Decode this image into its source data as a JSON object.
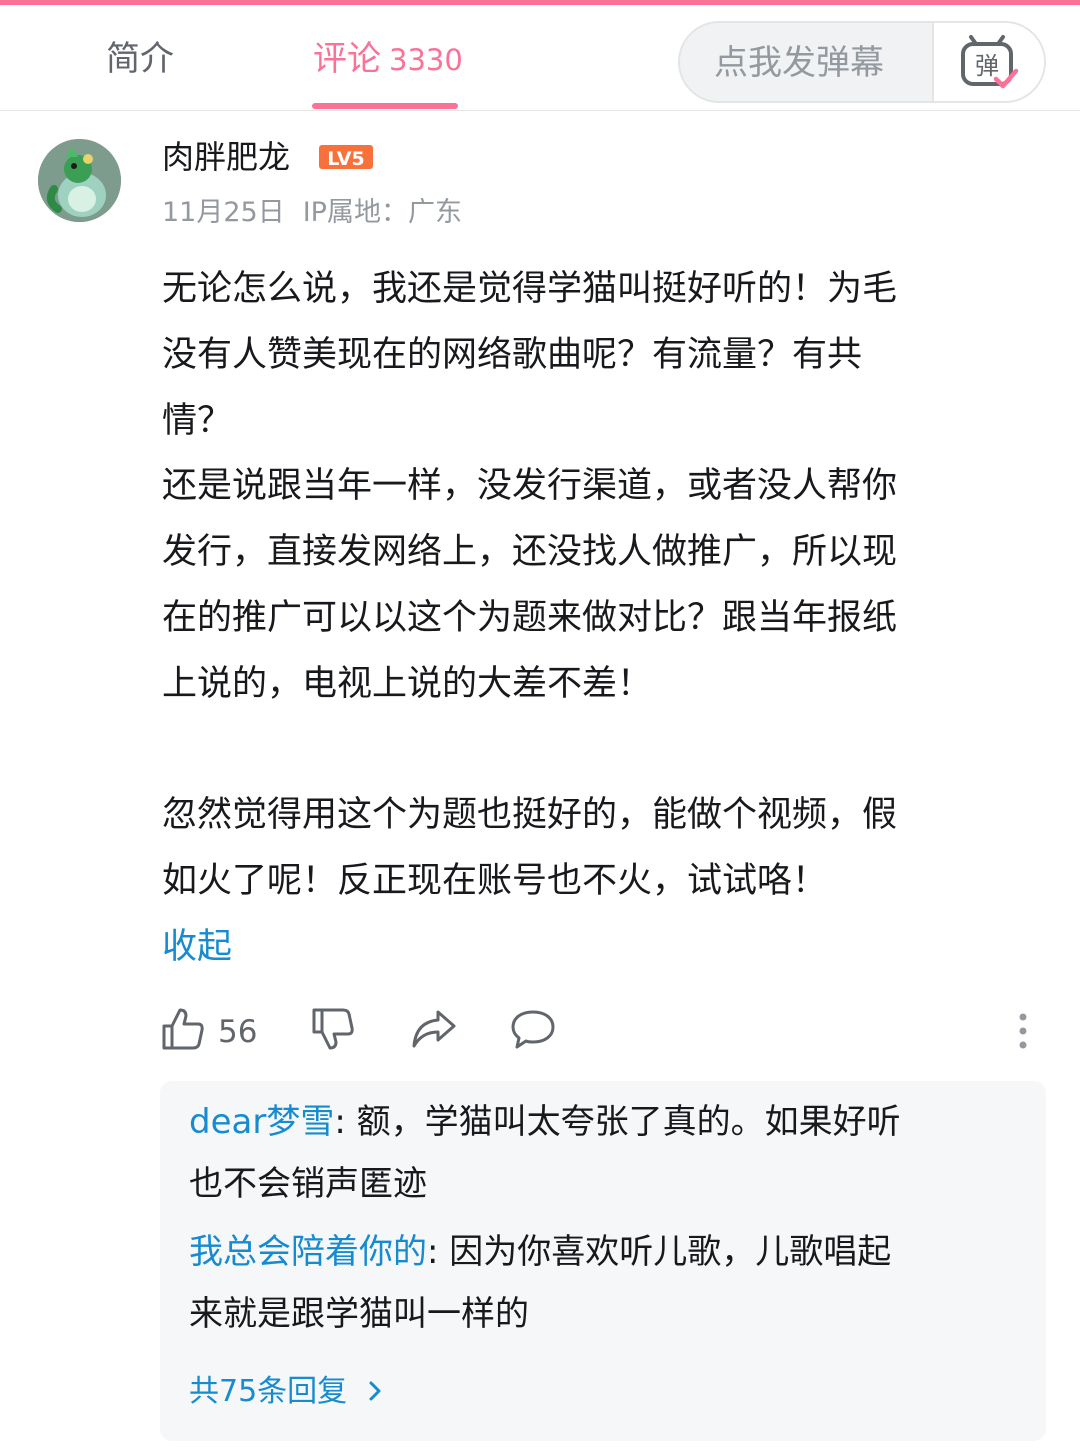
{
  "tabs": {
    "intro_label": "简介",
    "comments_label": "评论",
    "comments_count": "3330"
  },
  "danmaku": {
    "placeholder": "点我发弹幕",
    "button_icon": "danmaku-toggle-icon",
    "button_glyph": "弹"
  },
  "comment": {
    "username": "肉胖肥龙",
    "level": "LV5",
    "date": "11月25日",
    "ip": "IP属地：广东",
    "lines": [
      "无论怎么说，我还是觉得学猫叫挺好听的！为毛",
      "没有人赞美现在的网络歌曲呢？有流量？有共",
      "情？",
      "还是说跟当年一样，没发行渠道，或者没人帮你",
      "发行，直接发网络上，还没找人做推广，所以现",
      "在的推广可以以这个为题来做对比？跟当年报纸",
      "上说的，电视上说的大差不差！",
      "",
      "忽然觉得用这个为题也挺好的，能做个视频，假",
      "如火了呢！反正现在账号也不火，试试咯！"
    ],
    "collapse_label": "收起",
    "like_count": "56",
    "icons": [
      "thumbs-up-icon",
      "thumbs-down-icon",
      "share-icon",
      "reply-bubble-icon",
      "more-vertical-icon"
    ]
  },
  "replies": [
    {
      "name": "dear梦雪",
      "text_line1": ": 额，学猫叫太夸张了真的。如果好听",
      "text_line2": "也不会销声匿迹"
    },
    {
      "name": "我总会陪着你的",
      "text_line1": ": 因为你喜欢听儿歌，儿歌唱起",
      "text_line2": "来就是跟学猫叫一样的"
    }
  ],
  "reply_more_label": "共75条回复",
  "colors": {
    "accent_pink": "#fb7299",
    "link_blue": "#178bcf",
    "level_orange": "#f8713b",
    "muted_gray": "#9499a0"
  }
}
